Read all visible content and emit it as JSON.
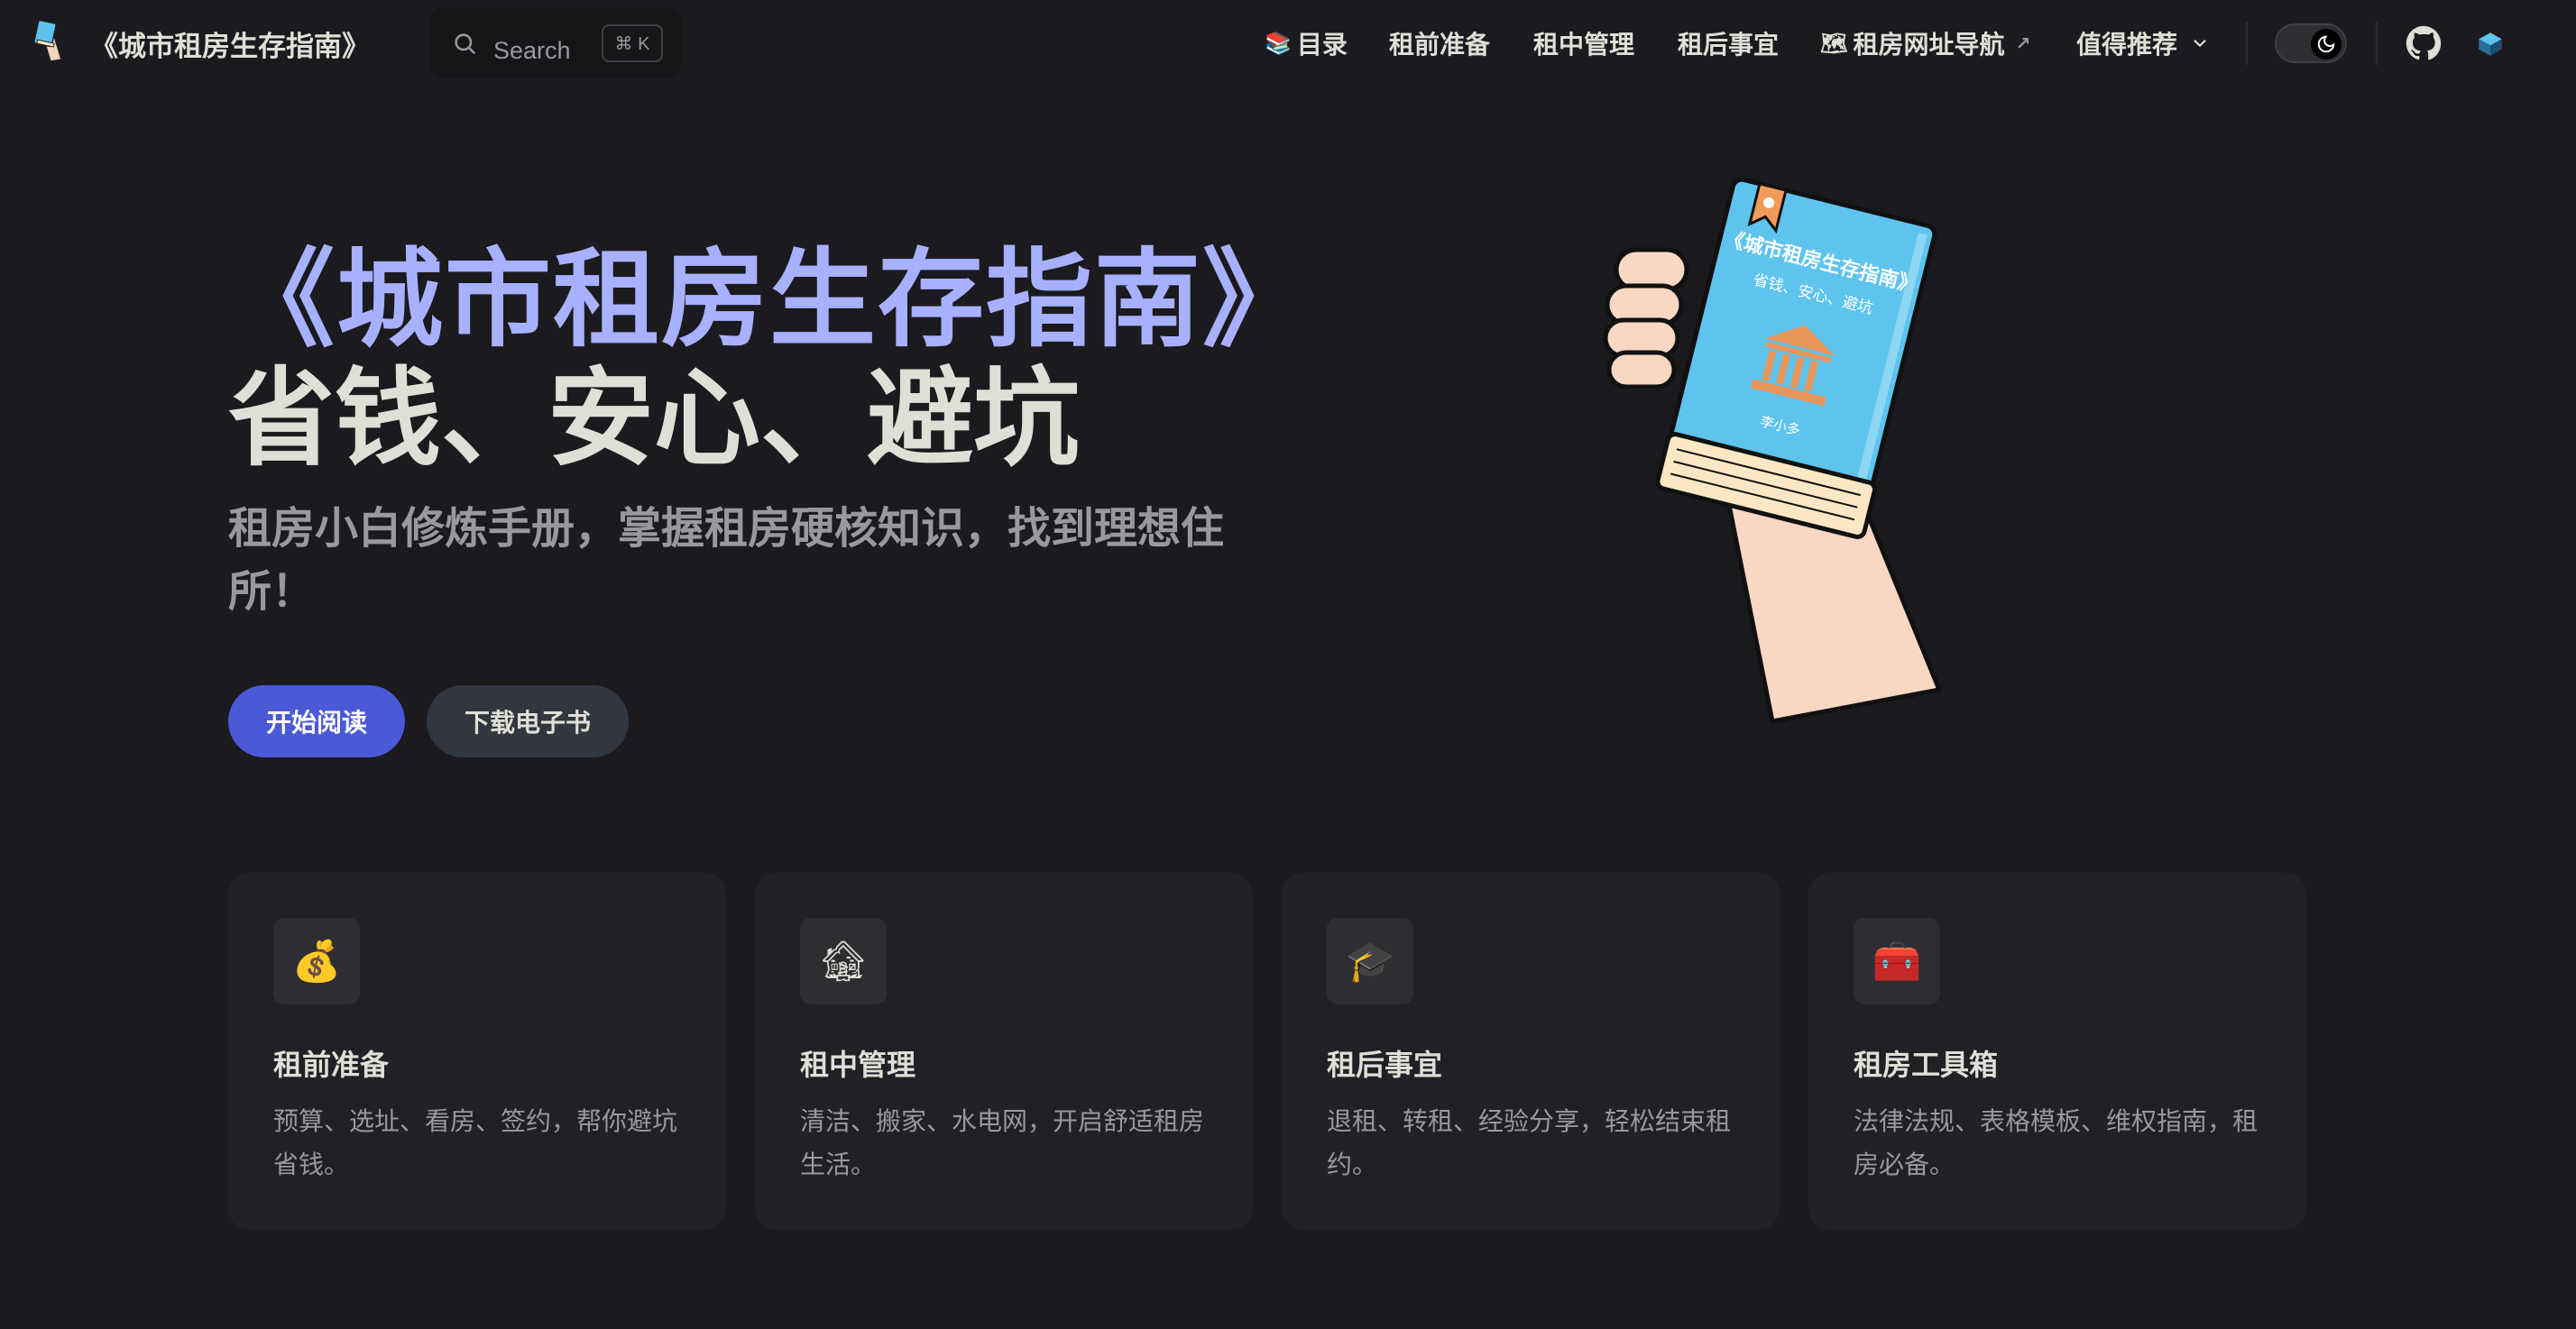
{
  "nav": {
    "title": "《城市租房生存指南》",
    "search_placeholder": "Search",
    "search_shortcut": "⌘ K",
    "items": [
      {
        "label": "目录",
        "icon": "books-icon",
        "glyph": "📚"
      },
      {
        "label": "租前准备"
      },
      {
        "label": "租中管理"
      },
      {
        "label": "租后事宜"
      },
      {
        "label": "租房网址导航",
        "icon": "map-icon",
        "glyph": "🗺",
        "external_glyph": "↗"
      },
      {
        "label": "值得推荐",
        "dropdown_glyph": "⌄"
      }
    ],
    "appearance_toggle": "dark-mode",
    "social_icons": [
      "github-icon",
      "cube-icon"
    ]
  },
  "hero": {
    "name": "《城市租房生存指南》",
    "text": "省钱、安心、避坑",
    "tagline": "租房小白修炼手册，掌握租房硬核知识，找到理想住所！",
    "actions": [
      {
        "label": "开始阅读",
        "theme": "brand"
      },
      {
        "label": "下载电子书",
        "theme": "alt"
      }
    ],
    "image": {
      "title": "《城市租房生存指南》",
      "subtitle": "省钱、安心、避坑",
      "author": "李小多"
    }
  },
  "features": [
    {
      "icon": "money-bag-icon",
      "glyph": "💰",
      "title": "租前准备",
      "details": "预算、选址、看房、签约，帮你避坑省钱。"
    },
    {
      "icon": "house-icon",
      "glyph": "🏚",
      "title": "租中管理",
      "details": "清洁、搬家、水电网，开启舒适租房生活。"
    },
    {
      "icon": "graduation-cap-icon",
      "glyph": "🎓",
      "title": "租后事宜",
      "details": "退租、转租、经验分享，轻松结束租约。"
    },
    {
      "icon": "toolbox-icon",
      "glyph": "🧰",
      "title": "租房工具箱",
      "details": "法律法规、表格模板、维权指南，租房必备。"
    }
  ],
  "colors": {
    "background": "#1b1b1f",
    "brand": "#4a5ad6",
    "hero_name": "#a8b1ff",
    "card": "#202127",
    "text": "#dfdfd6",
    "muted": "#98989f"
  }
}
